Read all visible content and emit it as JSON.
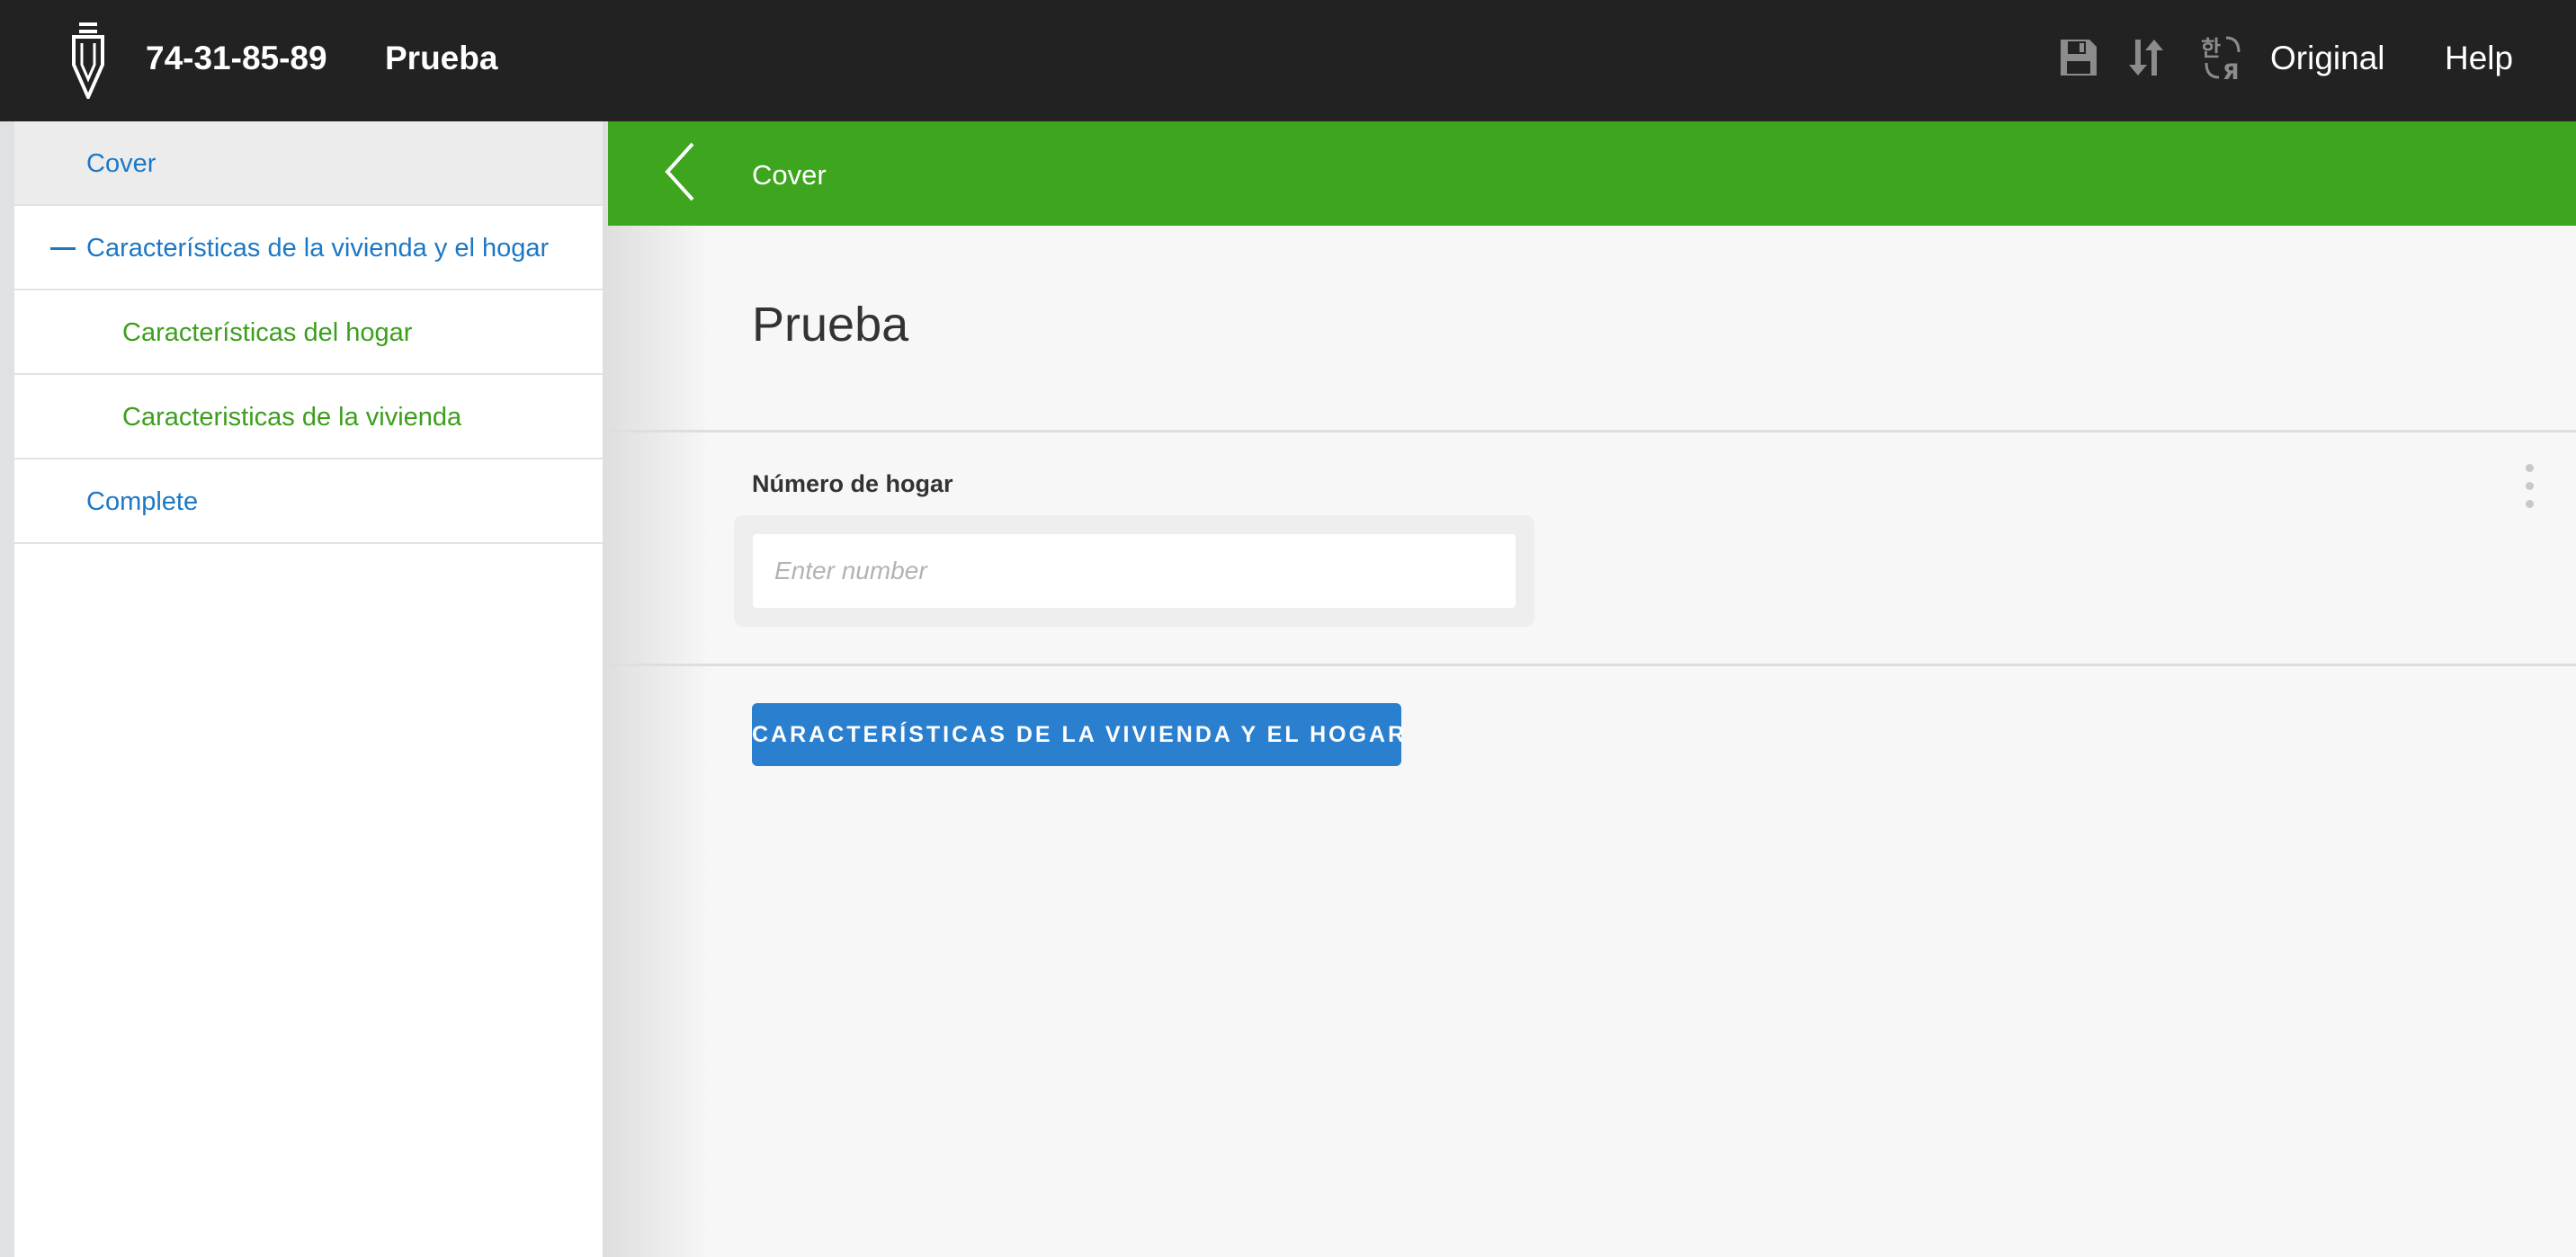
{
  "header": {
    "interview_id": "74-31-85-89",
    "questionnaire_title": "Prueba",
    "language_label": "Original",
    "help_label": "Help",
    "icons": [
      "logo-icon",
      "save-icon",
      "sort-icon",
      "translate-icon"
    ]
  },
  "sidebar": {
    "items": [
      {
        "label": "Cover",
        "color": "#1d78c4",
        "active": true
      },
      {
        "label": "Características de la vivienda y el hogar",
        "color": "#1d78c4",
        "expanded": true
      },
      {
        "label": "Características del hogar",
        "color": "#3b9f1c"
      },
      {
        "label": "Caracteristicas de la vivienda",
        "color": "#3b9f1c"
      },
      {
        "label": "Complete",
        "color": "#1d78c4"
      }
    ]
  },
  "section_bar": {
    "title": "Cover",
    "color": "#3da61e"
  },
  "main": {
    "page_title": "Prueba",
    "question": {
      "label": "Número de hogar",
      "value": "",
      "placeholder": "Enter number"
    },
    "next_section_button": "CARACTERÍSTICAS DE LA VIVIENDA Y EL HOGAR",
    "button_color": "#2a7fcf"
  }
}
